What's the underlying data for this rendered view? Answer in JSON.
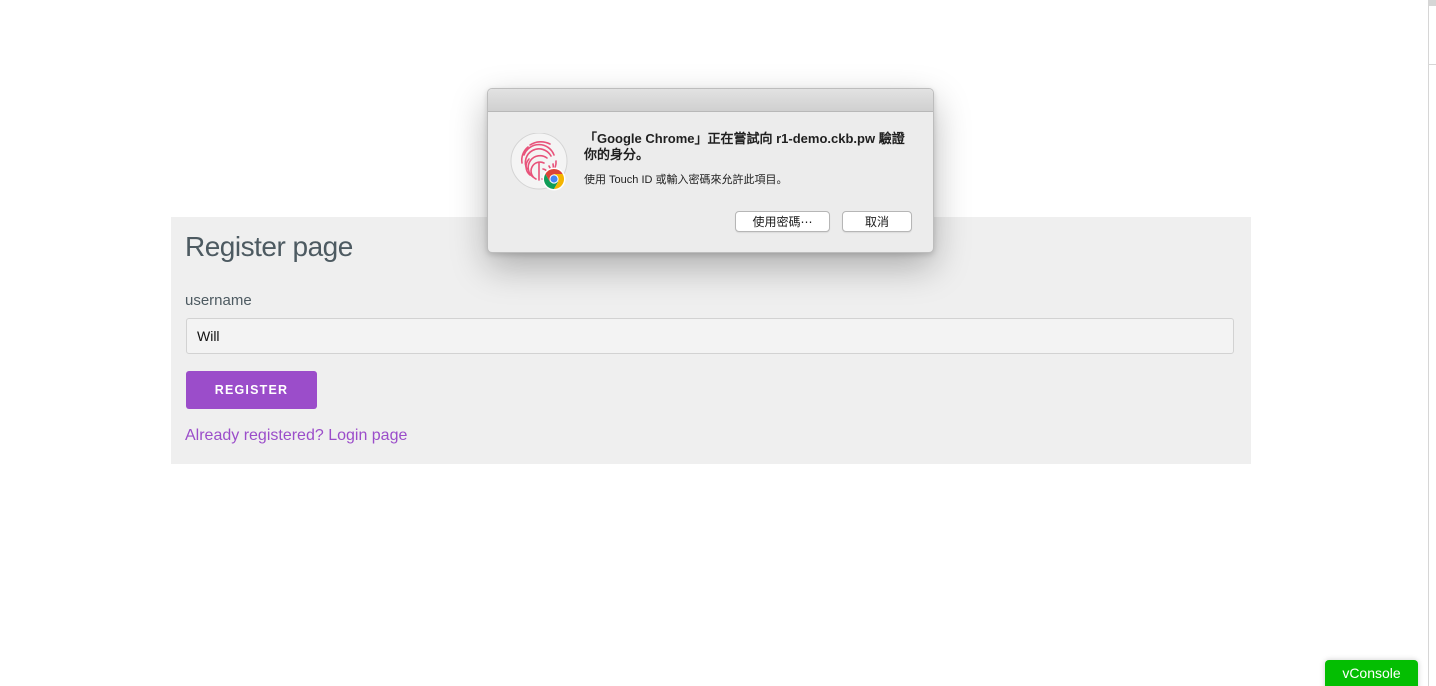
{
  "register": {
    "title": "Register page",
    "username_label": "username",
    "username_value": "Will",
    "register_button": "REGISTER",
    "login_link": "Already registered? Login page"
  },
  "dialog": {
    "heading": "「Google Chrome」正在嘗試向 r1-demo.ckb.pw 驗證你的身分。",
    "message": "使用 Touch ID 或輸入密碼來允許此項目。",
    "use_password_button": "使用密碼⋯",
    "cancel_button": "取消",
    "icon": "touch-id-fingerprint-icon",
    "badge_icon": "google-chrome-icon"
  },
  "vconsole": {
    "label": "vConsole"
  },
  "colors": {
    "accent": "#9b4dca",
    "panel_bg": "#efefef",
    "vconsole_green": "#04be02",
    "fingerprint": "#e8527a"
  }
}
